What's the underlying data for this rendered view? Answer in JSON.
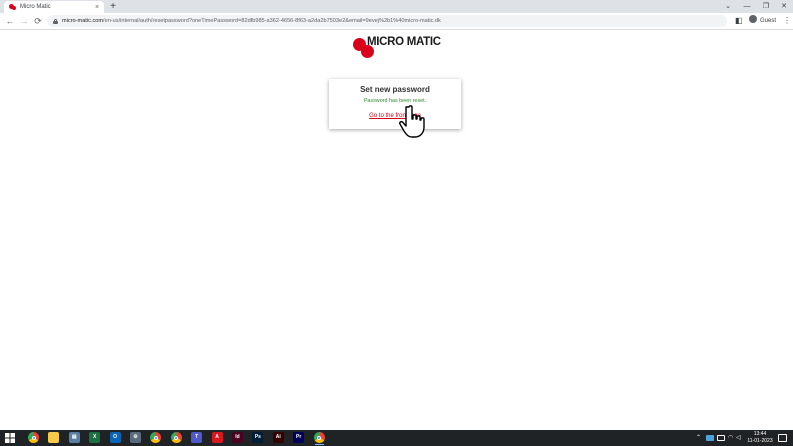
{
  "browser": {
    "tab_title": "Micro Matic",
    "tab_close": "×",
    "new_tab": "+",
    "url_host": "micro-matic.com",
    "url_path": "/en-us/internal/auth/resetpassword?oneTimePassword=82dfb985-a362-4656-8f63-a2da2b7503e2&email=9evej%2b1%40micro-matic.dk",
    "profile_label": "Guest",
    "back": "←",
    "forward": "→",
    "reload": "⟳",
    "minimize": "—",
    "restore": "❐",
    "close": "✕",
    "chevron": "⌄",
    "menu": "⋮",
    "sidebar_icon": "◧"
  },
  "page": {
    "logo_text": "MICRO MATIC",
    "card_title": "Set new password",
    "card_message": "Password has been reset.",
    "card_link": "Go to the frontpage"
  },
  "taskbar": {
    "time": "13:44",
    "date": "11-01-2023",
    "apps": [
      {
        "name": "chrome-icon",
        "color": "#4285f4",
        "glyph": ""
      },
      {
        "name": "sticky-notes-icon",
        "color": "#f7c948",
        "glyph": ""
      },
      {
        "name": "file-explorer-icon",
        "color": "#5b7fa3",
        "glyph": "▤"
      },
      {
        "name": "excel-icon",
        "color": "#1d7044",
        "glyph": "X"
      },
      {
        "name": "outlook-icon",
        "color": "#0a64b8",
        "glyph": "O"
      },
      {
        "name": "settings-icon",
        "color": "#5a6b7c",
        "glyph": "⚙"
      },
      {
        "name": "chrome-icon-2",
        "color": "#4285f4",
        "glyph": ""
      },
      {
        "name": "chrome-icon-3",
        "color": "#4285f4",
        "glyph": ""
      },
      {
        "name": "teams-icon",
        "color": "#5059c9",
        "glyph": "T"
      },
      {
        "name": "acrobat-icon",
        "color": "#d7191f",
        "glyph": "A"
      },
      {
        "name": "indesign-icon",
        "color": "#49021f",
        "glyph": "Id"
      },
      {
        "name": "photoshop-icon",
        "color": "#001e36",
        "glyph": "Ps"
      },
      {
        "name": "illustrator-icon",
        "color": "#330000",
        "glyph": "Ai"
      },
      {
        "name": "premiere-icon",
        "color": "#00005b",
        "glyph": "Pr"
      },
      {
        "name": "chrome-icon-active",
        "color": "#4285f4",
        "glyph": ""
      }
    ]
  },
  "colors": {
    "brand": "#d9001b",
    "success": "#2e8b2e"
  }
}
